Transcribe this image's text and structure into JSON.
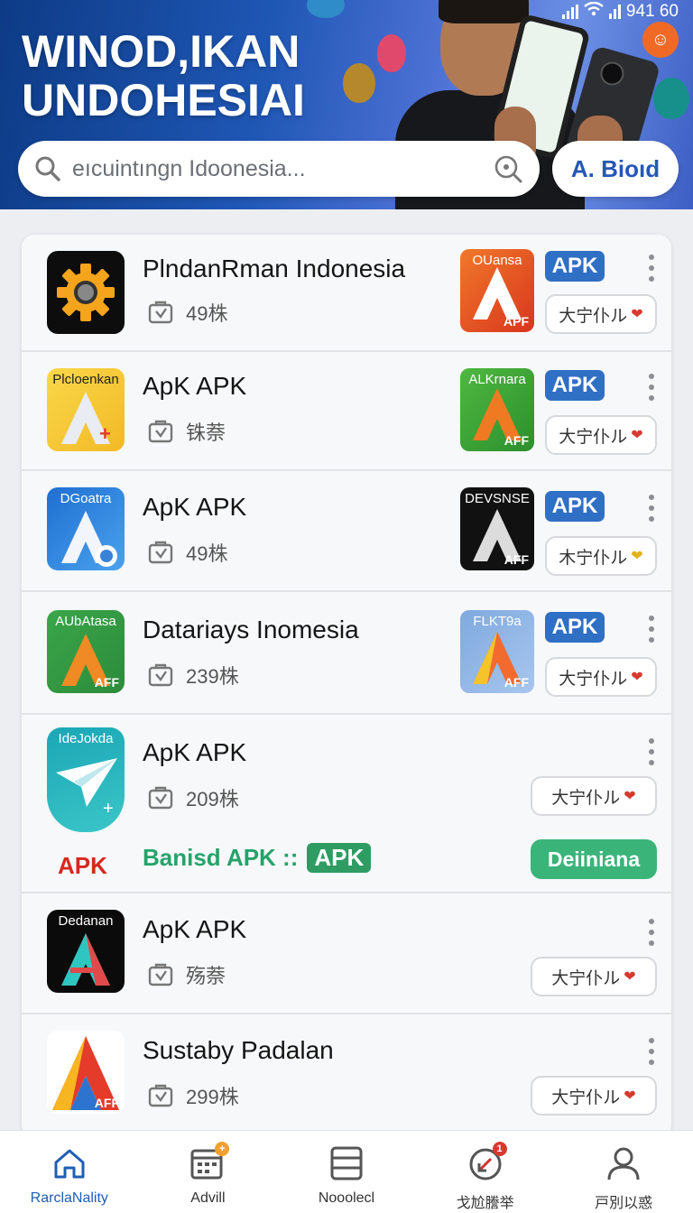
{
  "header": {
    "title_line1": "WINOD,IKAN",
    "title_line2": "UNDOHESIAI",
    "status_time": "941 60",
    "search_placeholder": "eıcuintıngn Idoonesia...",
    "action_button": "A. Bioıd"
  },
  "apps": [
    {
      "name": "PlndanRman Indonesia",
      "meta": "49株",
      "icon_text": "",
      "thumb_text": "OUansa",
      "thumb_aff": "APF",
      "badge": "APK",
      "download": "大宁仆ル",
      "heart_color": "#d63a2f"
    },
    {
      "name": "ApK APK",
      "meta": "铢萘",
      "icon_text": "Plcloenkan",
      "thumb_text": "ALKrnara",
      "thumb_aff": "AFF",
      "badge": "APK",
      "download": "大宁仆ル",
      "heart_color": "#d63a2f"
    },
    {
      "name": "ApK APK",
      "meta": "49株",
      "icon_text": "DGoatra",
      "thumb_text": "DEVSNSE",
      "thumb_aff": "AFF",
      "badge": "APK",
      "download": "木宁仆ル",
      "heart_color": "#e2b21a"
    },
    {
      "name": "Datariays Inomesia",
      "meta": "239株",
      "icon_text": "AUbAtasa",
      "icon_aff": "AFF",
      "thumb_text": "FLKT9a",
      "thumb_aff": "AFF",
      "badge": "APK",
      "download": "大宁仆ル",
      "heart_color": "#d63a2f"
    },
    {
      "name": "ApK APK",
      "meta": "209株",
      "icon_text": "IdeJokda",
      "download": "大宁仆ル",
      "heart_color": "#d63a2f",
      "banner_text": "Banisd APK ::",
      "banner_badge": "APK",
      "banner_button": "Deiiniana",
      "red_label": "APK"
    },
    {
      "name": "ApK APK",
      "meta": "殇萘",
      "icon_text": "Dedanan",
      "download": "大宁仆ル",
      "heart_color": "#d63a2f"
    },
    {
      "name": "Sustaby Padalan",
      "meta": "299株",
      "icon_aff": "AFF",
      "download": "大宁仆ル",
      "heart_color": "#d63a2f"
    }
  ],
  "nav": [
    {
      "label": "RarclaNality",
      "icon": "home-icon"
    },
    {
      "label": "Advill",
      "icon": "calendar-icon",
      "badge_color": "#f0a030"
    },
    {
      "label": "Nooolecl",
      "icon": "list-icon"
    },
    {
      "label": "戈尬謄举",
      "icon": "notification-icon",
      "badge": "1",
      "badge_color": "#d63a2f"
    },
    {
      "label": "戸別以惑",
      "icon": "profile-icon"
    }
  ]
}
